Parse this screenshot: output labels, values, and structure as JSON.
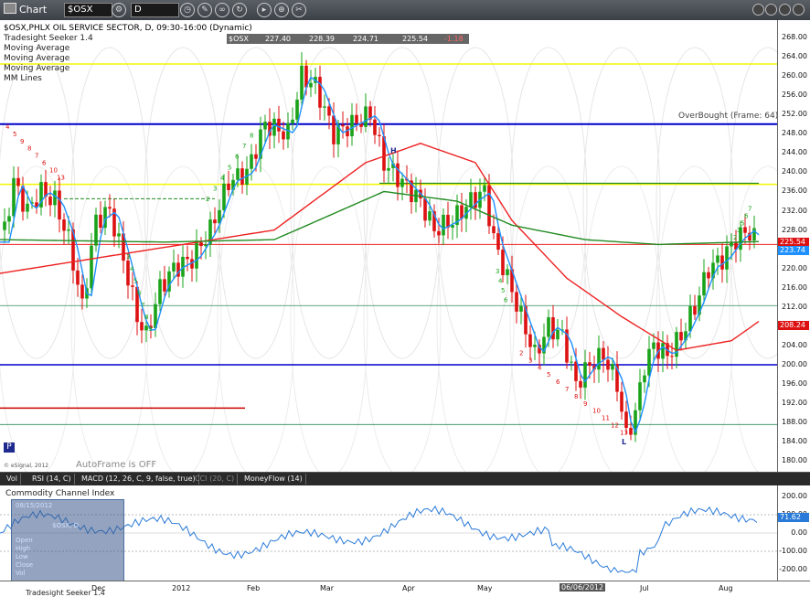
{
  "toolbar": {
    "title": "Chart",
    "symbol": "$OSX",
    "period": "D"
  },
  "legend": {
    "title": "$OSX,PHLX OIL SERVICE SECTOR, D, 09:30-16:00 (Dynamic)",
    "studies": [
      "Tradesight Seeker 1.4",
      "Moving Average",
      "Moving Average",
      "Moving Average",
      "MM Lines"
    ]
  },
  "ohlc": {
    "symbol": "$OSX",
    "open": "227.40",
    "high": "228.39",
    "low": "224.71",
    "close": "225.54",
    "change": "-1.18"
  },
  "overbought_label": "OverBought (Frame: 64)",
  "autoframe_label": "AutoFrame is OFF",
  "copyright": "© eSignal, 2012",
  "p_badge": "P",
  "colors": {
    "up_candle": "#1aa31a",
    "down_candle": "#dd1111",
    "blue_ma": "#1e90ff",
    "red_ma": "#ee2222",
    "green_ma": "#228b22",
    "mm_blue": "#0000cc",
    "mm_yellow": "#f5f500",
    "cci_line": "#2a7ad9"
  },
  "price_axis": [
    "268.00",
    "264.00",
    "260.00",
    "256.00",
    "252.00",
    "248.00",
    "244.00",
    "240.00",
    "236.00",
    "232.00",
    "228.00",
    "224.00",
    "220.00",
    "216.00",
    "212.00",
    "208.00",
    "204.00",
    "200.00",
    "196.00",
    "192.00",
    "188.00",
    "184.00",
    "180.00"
  ],
  "price_tags": [
    {
      "value": "225.54",
      "color": "#dd1111"
    },
    {
      "value": "223.74",
      "color": "#1e90ff"
    },
    {
      "value": "208.24",
      "color": "#dd1111"
    }
  ],
  "tabs": [
    "Vol",
    "RSI (14, C)",
    "MACD (12, 26, C, 9, false, true)",
    "CCI (20, C)",
    "MoneyFlow (14)"
  ],
  "cci": {
    "title": "Commodity Channel Index",
    "axis": [
      "200.00",
      "100.00",
      "0.00",
      "-100.00",
      "-200.00"
    ],
    "last_value": "71.62"
  },
  "info_box": {
    "date": "08/15/2012",
    "symbol": "$OSX, D",
    "rows": [
      "Open",
      "High",
      "Low",
      "Close",
      "Vol"
    ]
  },
  "date_axis": [
    "Dec",
    "2012",
    "Feb",
    "Mar",
    "Apr",
    "May",
    "06/06/2012",
    "Jul",
    "Aug"
  ],
  "bottom_legend": "Tradesight Seeker 1.4",
  "seeker_counts": {
    "red_top_left": [
      "4",
      "5",
      "9",
      "8",
      "7",
      "6",
      "10",
      "13"
    ],
    "green_left": [
      "3",
      "4",
      "5",
      "6",
      "7",
      "8",
      "9"
    ],
    "green_mid": [
      "2",
      "3",
      "4",
      "5",
      "6",
      "7",
      "8"
    ],
    "green_may": [
      "3",
      "4",
      "5",
      "6"
    ],
    "red_may_jun": [
      "2",
      "3",
      "4",
      "5",
      "6",
      "7",
      "8",
      "9",
      "10",
      "11",
      "12",
      "13"
    ],
    "green_aug": [
      "2",
      "3",
      "5",
      "6",
      "7"
    ],
    "seeker_letters": [
      "H",
      "L"
    ]
  }
}
